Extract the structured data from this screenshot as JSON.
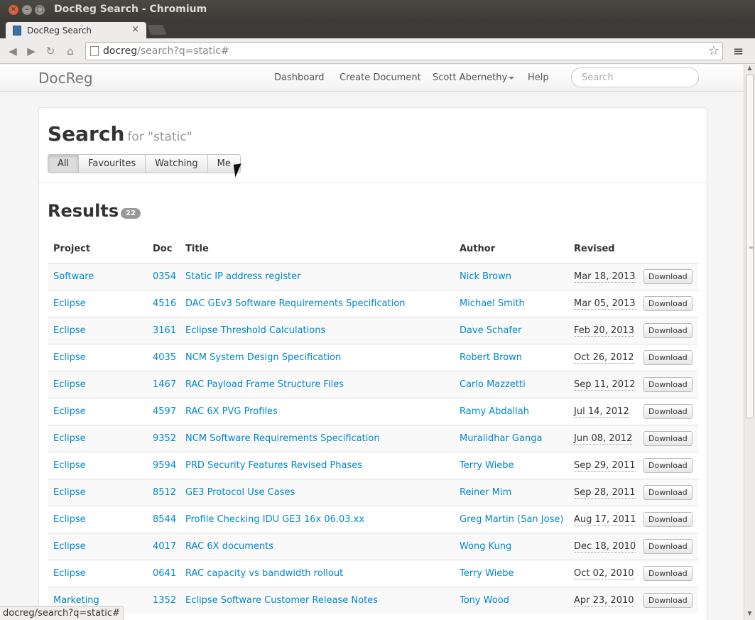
{
  "window": {
    "title": "DocReg Search - Chromium"
  },
  "browser": {
    "tab_title": "DocReg Search",
    "url_host": "docreg",
    "url_path": "/search?q=static#",
    "status_text": "docreg/search?q=static#"
  },
  "navbar": {
    "brand": "DocReg",
    "items": [
      {
        "label": "Dashboard"
      },
      {
        "label": "Create Document"
      },
      {
        "label": "Scott Abernethy"
      },
      {
        "label": "Help"
      }
    ],
    "search_placeholder": "Search"
  },
  "page": {
    "title": "Search",
    "subtitle": "for \"static\"",
    "filters": [
      {
        "label": "All",
        "active": true
      },
      {
        "label": "Favourites",
        "active": false
      },
      {
        "label": "Watching",
        "active": false
      },
      {
        "label": "Me",
        "active": false
      }
    ],
    "results_title": "Results",
    "results_count": "22"
  },
  "table": {
    "headers": [
      "Project",
      "Doc",
      "Title",
      "Author",
      "Revised"
    ],
    "download_label": "Download",
    "rows": [
      {
        "project": "Software",
        "doc": "0354",
        "title": "Static IP address register",
        "author": "Nick Brown",
        "revised": "Mar 18, 2013"
      },
      {
        "project": "Eclipse",
        "doc": "4516",
        "title": "DAC GEv3 Software Requirements Specification",
        "author": "Michael Smith",
        "revised": "Mar 05, 2013"
      },
      {
        "project": "Eclipse",
        "doc": "3161",
        "title": "Eclipse Threshold Calculations",
        "author": "Dave Schafer",
        "revised": "Feb 20, 2013"
      },
      {
        "project": "Eclipse",
        "doc": "4035",
        "title": "NCM System Design Specification",
        "author": "Robert Brown",
        "revised": "Oct 26, 2012"
      },
      {
        "project": "Eclipse",
        "doc": "1467",
        "title": "RAC Payload Frame Structure Files",
        "author": "Carlo Mazzetti",
        "revised": "Sep 11, 2012"
      },
      {
        "project": "Eclipse",
        "doc": "4597",
        "title": "RAC 6X PVG Profiles",
        "author": "Ramy Abdallah",
        "revised": "Jul 14, 2012"
      },
      {
        "project": "Eclipse",
        "doc": "9352",
        "title": "NCM Software Requirements Specification",
        "author": "Muralidhar Ganga",
        "revised": "Jun 08, 2012"
      },
      {
        "project": "Eclipse",
        "doc": "9594",
        "title": "PRD Security Features Revised Phases",
        "author": "Terry Wiebe",
        "revised": "Sep 29, 2011"
      },
      {
        "project": "Eclipse",
        "doc": "8512",
        "title": "GE3 Protocol Use Cases",
        "author": "Reiner Mim",
        "revised": "Sep 28, 2011"
      },
      {
        "project": "Eclipse",
        "doc": "8544",
        "title": "Profile Checking IDU GE3 16x 06.03.xx",
        "author": "Greg Martin (San Jose)",
        "revised": "Aug 17, 2011"
      },
      {
        "project": "Eclipse",
        "doc": "4017",
        "title": "RAC 6X documents",
        "author": "Wong Kung",
        "revised": "Dec 18, 2010"
      },
      {
        "project": "Eclipse",
        "doc": "0641",
        "title": "RAC capacity vs bandwidth rollout",
        "author": "Terry Wiebe",
        "revised": "Oct 02, 2010"
      },
      {
        "project": "Marketing",
        "doc": "1352",
        "title": "Eclipse Software Customer Release Notes",
        "author": "Tony Wood",
        "revised": "Apr 23, 2010"
      }
    ]
  }
}
